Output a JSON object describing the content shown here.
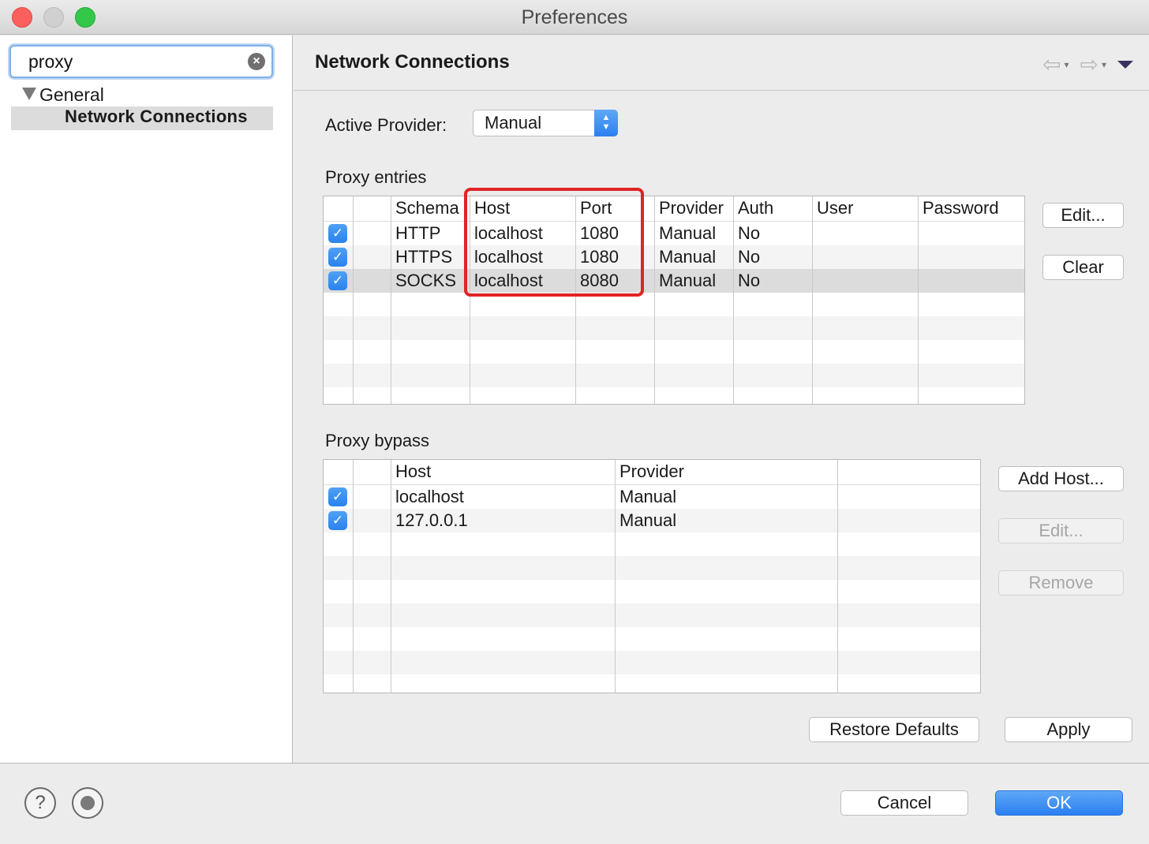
{
  "window": {
    "title": "Preferences"
  },
  "sidebar": {
    "search": {
      "value": "proxy",
      "clear_icon": "×"
    },
    "tree": {
      "group": "General",
      "selected": "Network Connections"
    }
  },
  "main": {
    "title": "Network Connections",
    "nav": {
      "back_icon": "⇦",
      "forward_icon": "⇨",
      "dropdown_icon": "▾"
    },
    "active_provider": {
      "label": "Active Provider:",
      "value": "Manual"
    },
    "proxy_entries": {
      "label": "Proxy entries",
      "columns": [
        "Schema",
        "Host",
        "Port",
        "Provider",
        "Auth",
        "User",
        "Password"
      ],
      "rows": [
        {
          "checked": true,
          "schema": "HTTP",
          "host": "localhost",
          "port": "1080",
          "provider": "Manual",
          "auth": "No",
          "user": "",
          "password": ""
        },
        {
          "checked": true,
          "schema": "HTTPS",
          "host": "localhost",
          "port": "1080",
          "provider": "Manual",
          "auth": "No",
          "user": "",
          "password": ""
        },
        {
          "checked": true,
          "schema": "SOCKS",
          "host": "localhost",
          "port": "8080",
          "provider": "Manual",
          "auth": "No",
          "user": "",
          "password": ""
        }
      ],
      "buttons": {
        "edit": "Edit...",
        "clear": "Clear"
      }
    },
    "proxy_bypass": {
      "label": "Proxy bypass",
      "columns": [
        "Host",
        "Provider"
      ],
      "rows": [
        {
          "checked": true,
          "host": "localhost",
          "provider": "Manual"
        },
        {
          "checked": true,
          "host": "127.0.0.1",
          "provider": "Manual"
        }
      ],
      "buttons": {
        "add": "Add Host...",
        "edit": "Edit...",
        "remove": "Remove"
      }
    },
    "restore_defaults": "Restore Defaults",
    "apply": "Apply"
  },
  "footer": {
    "cancel": "Cancel",
    "ok": "OK",
    "help_icon": "?"
  },
  "colors": {
    "accent": "#2b7ff0",
    "highlight": "#e02424"
  }
}
